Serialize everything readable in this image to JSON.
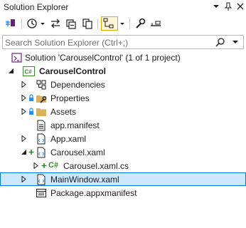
{
  "window": {
    "title": "Solution Explorer",
    "title_buttons": [
      "chevron-down-icon",
      "pin-icon",
      "close-icon"
    ]
  },
  "toolbar": {
    "buttons": [
      "switch-views-icon",
      "history-icon",
      "chevron-down-icon",
      "sync-icon",
      "collapse-all-icon",
      "show-all-files-icon",
      "toggle-view-icon",
      "chevron-down-icon",
      "properties-icon",
      "preview-icon"
    ]
  },
  "search": {
    "placeholder": "Search Solution Explorer (Ctrl+;)"
  },
  "tree": {
    "solution": "Solution 'CarouselControl' (1 of 1 project)",
    "project": "CarouselControl",
    "items": [
      {
        "label": "Dependencies"
      },
      {
        "label": "Properties"
      },
      {
        "label": "Assets"
      },
      {
        "label": "app.manifest"
      },
      {
        "label": "App.xaml"
      },
      {
        "label": "Carousel.xaml"
      },
      {
        "label": "Carousel.xaml.cs"
      },
      {
        "label": "MainWindow.xaml"
      },
      {
        "label": "Package.appxmanifest"
      }
    ],
    "cs_badge": "C#",
    "selected": "MainWindow.xaml"
  },
  "colors": {
    "accent": "#0078d7",
    "selection_bg": "#cce8ff",
    "lock_blue": "#1e90ff",
    "pending_green": "#2e8b2e",
    "folder": "#dcb35c",
    "cs_green": "#3c8a2e",
    "vs_purple": "#68217a"
  }
}
